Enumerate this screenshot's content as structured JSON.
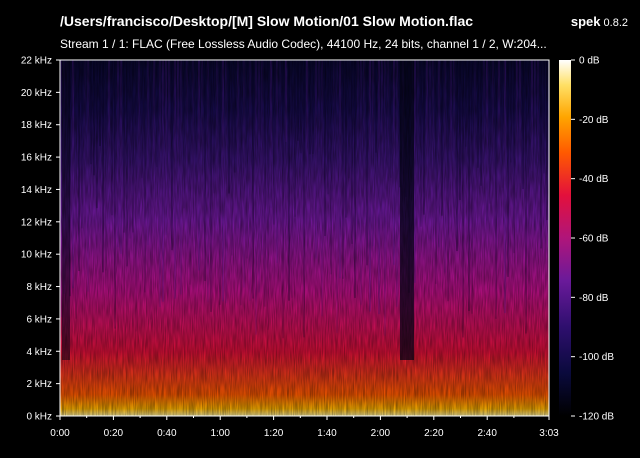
{
  "window": {
    "file_path": "/Users/francisco/Desktop/[M] Slow Motion/01 Slow Motion.flac",
    "app_name": "spek",
    "app_version": "0.8.2",
    "stream_info": "Stream 1 / 1: FLAC (Free Lossless Audio Codec), 44100 Hz, 24 bits, channel 1 / 2, W:204..."
  },
  "frequency_axis": {
    "labels": [
      "0 kHz",
      "2 kHz",
      "4 kHz",
      "6 kHz",
      "8 kHz",
      "10 kHz",
      "12 kHz",
      "14 kHz",
      "16 kHz",
      "18 kHz",
      "20 kHz",
      "22 kHz"
    ],
    "range_khz": [
      0,
      22
    ]
  },
  "time_axis": {
    "labels": [
      "0:00",
      "0:20",
      "0:40",
      "1:00",
      "1:20",
      "1:40",
      "2:00",
      "2:20",
      "2:40",
      "3:03"
    ]
  },
  "level_scale": {
    "labels": [
      "0 dB",
      "-20 dB",
      "-40 dB",
      "-60 dB",
      "-80 dB",
      "-100 dB",
      "-120 dB"
    ],
    "range_db": [
      -120,
      0
    ],
    "colors": [
      "#000000",
      "#0a0a3c",
      "#2e0f6e",
      "#6a1a9a",
      "#b0157a",
      "#e3103c",
      "#ff5a00",
      "#ffa500",
      "#ffe066",
      "#ffffff"
    ]
  }
}
